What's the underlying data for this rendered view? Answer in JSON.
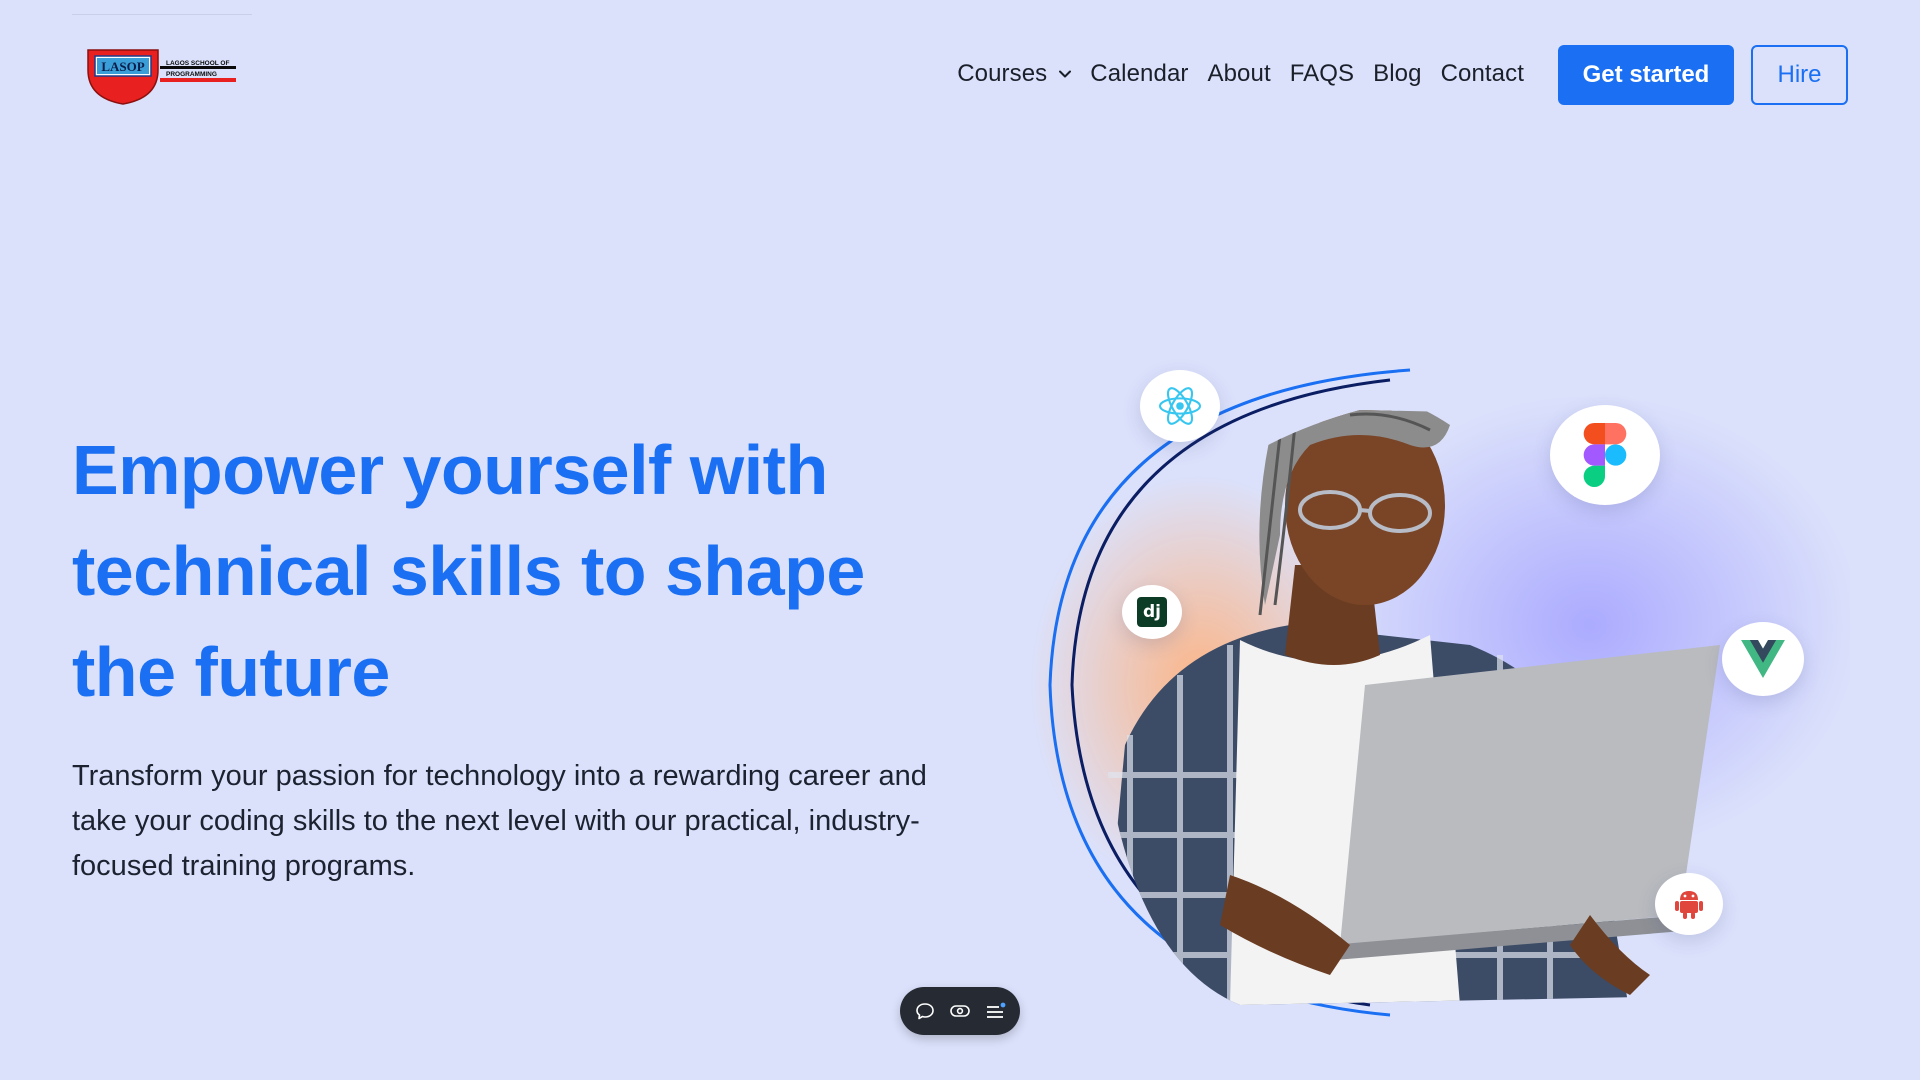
{
  "logo": {
    "name": "LASOP",
    "subtitle_line1": "LAGOS SCHOOL OF",
    "subtitle_line2": "PROGRAMMING"
  },
  "nav": {
    "items": [
      {
        "label": "Courses",
        "has_dropdown": true
      },
      {
        "label": "Calendar"
      },
      {
        "label": "About"
      },
      {
        "label": "FAQS"
      },
      {
        "label": "Blog"
      },
      {
        "label": "Contact"
      }
    ]
  },
  "buttons": {
    "get_started": "Get started",
    "hire": "Hire"
  },
  "hero": {
    "title": "Empower yourself with technical skills to shape the future",
    "subtitle": "Transform your passion for technology into a rewarding career and take your coding skills to the next level with our practical, industry-focused training programs."
  },
  "tech_badges": [
    {
      "icon": "react-icon"
    },
    {
      "icon": "figma-icon"
    },
    {
      "icon": "django-icon",
      "label": "dj"
    },
    {
      "icon": "vue-icon"
    },
    {
      "icon": "android-icon"
    }
  ],
  "toolbar": {
    "icons": [
      "comment-icon",
      "eye-icon",
      "menu-icon"
    ]
  },
  "colors": {
    "background": "#dbe1fb",
    "accent": "#1a6ff2",
    "text": "#1c2230",
    "toolbar": "#262a33"
  }
}
